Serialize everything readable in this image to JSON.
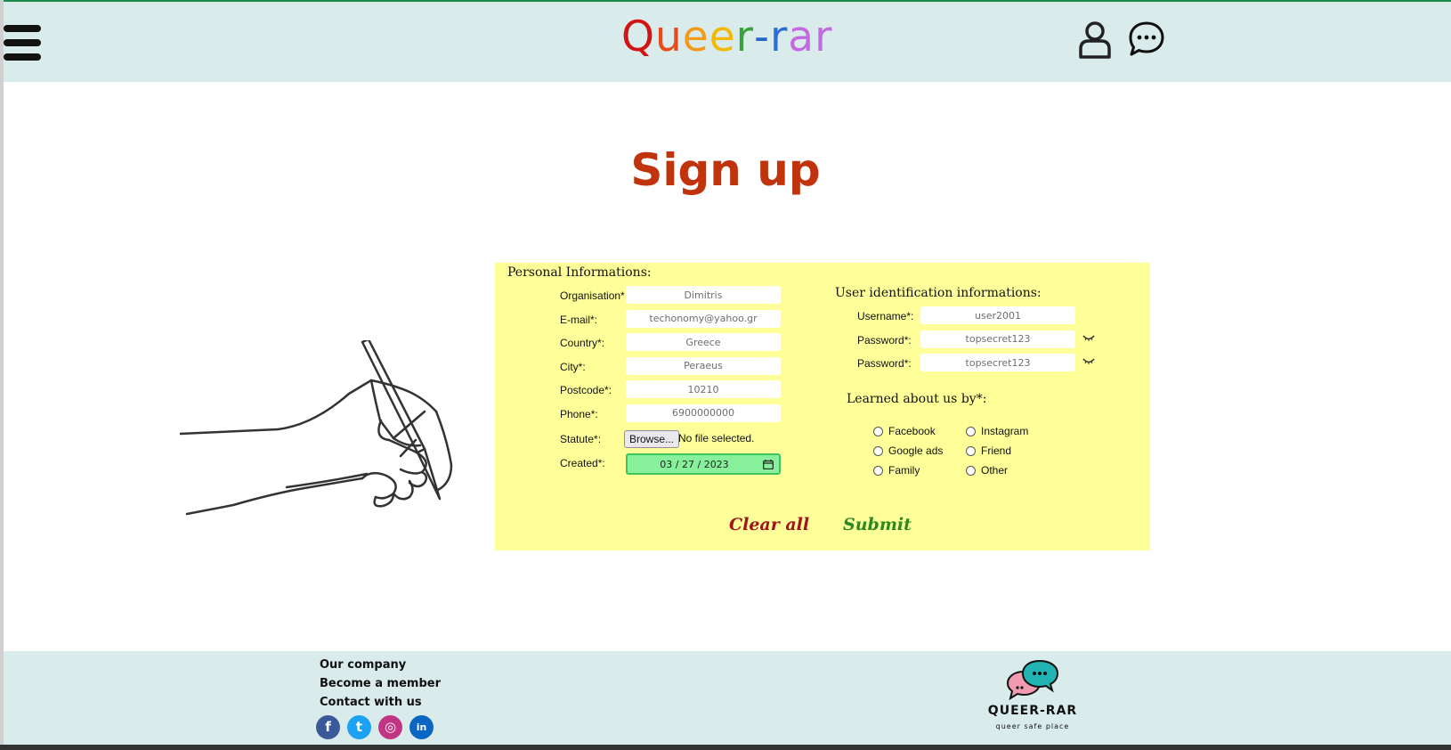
{
  "header": {
    "logo_letters": [
      {
        "char": "Q",
        "color": "#d21414"
      },
      {
        "char": "u",
        "color": "#e84a1a"
      },
      {
        "char": "e",
        "color": "#f39a1a"
      },
      {
        "char": "e",
        "color": "#f5b800"
      },
      {
        "char": "r",
        "color": "#3aa03a"
      },
      {
        "char": "-",
        "color": "#2468c9"
      },
      {
        "char": "r",
        "color": "#2a6fd6"
      },
      {
        "char": "a",
        "color": "#c46ae0"
      },
      {
        "char": "r",
        "color": "#c46ae0"
      }
    ],
    "icons": [
      "hamburger-menu-icon",
      "user-icon",
      "chat-icon"
    ]
  },
  "page_title": "Sign up",
  "form": {
    "personal_title": "Personal Informations:",
    "personal_fields": [
      {
        "label": "Organisation",
        "required": "*",
        "value": "Dimitris"
      },
      {
        "label": "E-mail",
        "required": "*:",
        "value": "techonomy@yahoo.gr"
      },
      {
        "label": "Country",
        "required": "*:",
        "value": "Greece"
      },
      {
        "label": "City",
        "required": "*:",
        "value": "Peraeus"
      },
      {
        "label": "Postcode",
        "required": "*:",
        "value": "10210"
      },
      {
        "label": "Phone",
        "required": "*:",
        "value": "6900000000"
      }
    ],
    "statute": {
      "label": "Statute",
      "required": "*:",
      "button": "Browse...",
      "status": "No file selected."
    },
    "created": {
      "label": "Created",
      "required": "*:",
      "value": "03 / 27 / 2023"
    },
    "user_title": "User identification informations:",
    "user_fields": [
      {
        "label": "Username",
        "required": "*:",
        "value": "user2001"
      },
      {
        "label": "Password",
        "required": "*:",
        "value": "topsecret123"
      },
      {
        "label": "Password",
        "required": "*:",
        "value": "topsecret123"
      }
    ],
    "learned_title": "Learned about us by*:",
    "learned_options": [
      {
        "label": "Facebook"
      },
      {
        "label": "Instagram"
      },
      {
        "label": "Google ads"
      },
      {
        "label": "Friend"
      },
      {
        "label": "Family"
      },
      {
        "label": "Other"
      }
    ],
    "clear_label": "Clear all",
    "submit_label": "Submit",
    "accent_colors": {
      "form_bg": "#ffff99",
      "clear": "#a0141e",
      "submit": "#2a8a1f",
      "title": "#c0330c"
    }
  },
  "footer": {
    "links": [
      "Our company",
      "Become a member",
      "Contact with us"
    ],
    "social": [
      {
        "name": "facebook-icon",
        "glyph": "f",
        "color": "#3b5998"
      },
      {
        "name": "twitter-icon",
        "glyph": "t",
        "color": "#1da1f2"
      },
      {
        "name": "instagram-icon",
        "glyph": "◎",
        "color": "#c13584"
      },
      {
        "name": "linkedin-icon",
        "glyph": "in",
        "color": "#0a66c2"
      }
    ],
    "brand_name": "QUEER-RAR",
    "brand_tagline": "queer safe place"
  }
}
